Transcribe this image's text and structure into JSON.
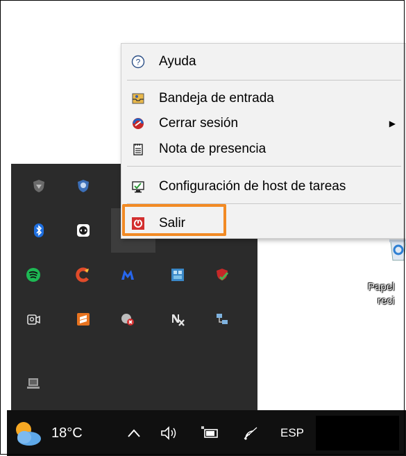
{
  "context_menu": {
    "items": [
      {
        "label": "Ayuda",
        "icon": "help-icon"
      },
      {
        "label": "Bandeja de entrada",
        "icon": "inbox-icon"
      },
      {
        "label": "Cerrar sesión",
        "icon": "logout-icon",
        "submenu_arrow": "▶"
      },
      {
        "label": "Nota de presencia",
        "icon": "notepad-icon"
      },
      {
        "label": "Configuración de host de tareas",
        "icon": "monitor-settings-icon"
      },
      {
        "label": "Salir",
        "icon": "exit-icon"
      }
    ]
  },
  "tray_icons": [
    "shield-outline-icon",
    "security-shield-icon",
    "bluetooth-icon",
    "teamviewer-icon",
    "chat-bubble-icon",
    "spotify-icon",
    "ccleaner-icon",
    "malwarebytes-icon",
    "network-grid-icon",
    "antivirus-check-icon",
    "camera-shutter-icon",
    "sublime-icon",
    "disk-error-icon",
    "nx-icon",
    "network-devices-icon",
    "laptop-icon"
  ],
  "taskbar": {
    "temperature": "18°C",
    "weather_icon": "weather-cloud-sun-icon",
    "language": "ESP"
  },
  "desktop": {
    "recycle_bin_label_line1": "Papel",
    "recycle_bin_label_line2": "reci"
  },
  "colors": {
    "highlight": "#f28a24",
    "menu_bg": "#f2f2f2",
    "tray_bg": "#2b2b2b",
    "taskbar_bg": "#101010"
  }
}
